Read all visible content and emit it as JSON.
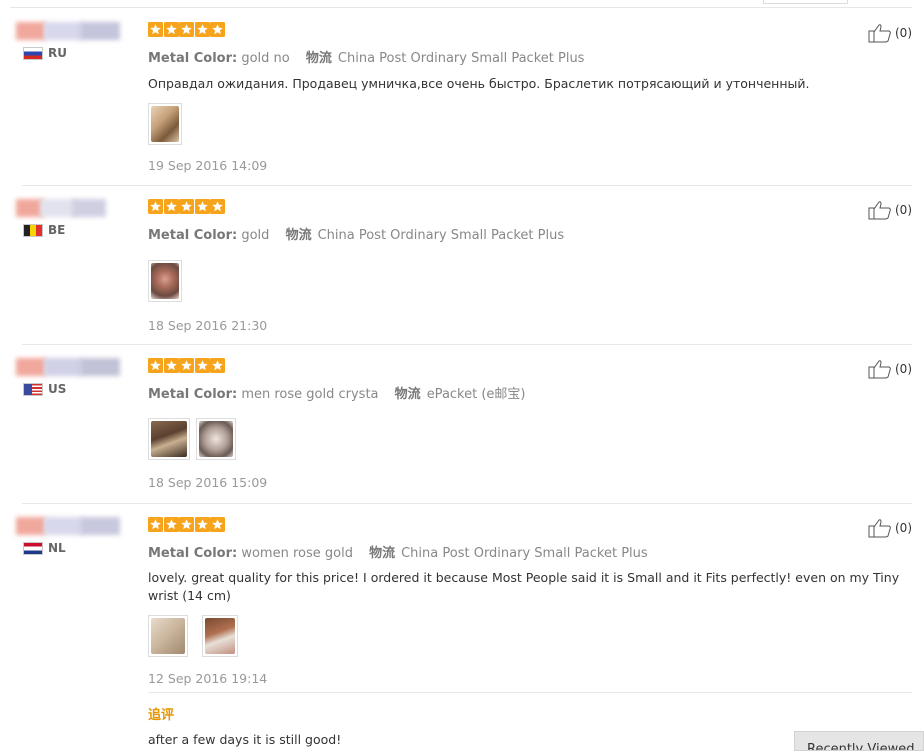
{
  "reviews": [
    {
      "country": "RU",
      "color_label": "Metal Color:",
      "color": "gold no",
      "ship_label": "物流",
      "ship": "China Post Ordinary Small Packet Plus",
      "text": "Оправдал ожидания. Продавец умничка,все очень быстро. Браслетик потрясающий и утонченный.",
      "date": "19 Sep 2016 14:09",
      "likes": "(0)",
      "stars": 5
    },
    {
      "country": "BE",
      "color_label": "Metal Color:",
      "color": "gold",
      "ship_label": "物流",
      "ship": "China Post Ordinary Small Packet Plus",
      "text": "",
      "date": "18 Sep 2016 21:30",
      "likes": "(0)",
      "stars": 5
    },
    {
      "country": "US",
      "color_label": "Metal Color:",
      "color": "men rose gold crysta",
      "ship_label": "物流",
      "ship": "ePacket (e邮宝)",
      "text": "",
      "date": "18 Sep 2016 15:09",
      "likes": "(0)",
      "stars": 5
    },
    {
      "country": "NL",
      "color_label": "Metal Color:",
      "color": "women rose gold",
      "ship_label": "物流",
      "ship": "China Post Ordinary Small Packet Plus",
      "text": "lovely. great quality for this price! I ordered it because Most People said it is Small and it Fits perfectly! even on my Tiny wrist (14 cm)",
      "date": "12 Sep 2016 19:14",
      "likes": "(0)",
      "stars": 5
    }
  ],
  "additional": {
    "label": "追评",
    "text": "after a few days it is still good!"
  },
  "recently_viewed": "Recently Viewed",
  "colors": {
    "star": "#f7a41d",
    "additional_label": "#e69500"
  }
}
